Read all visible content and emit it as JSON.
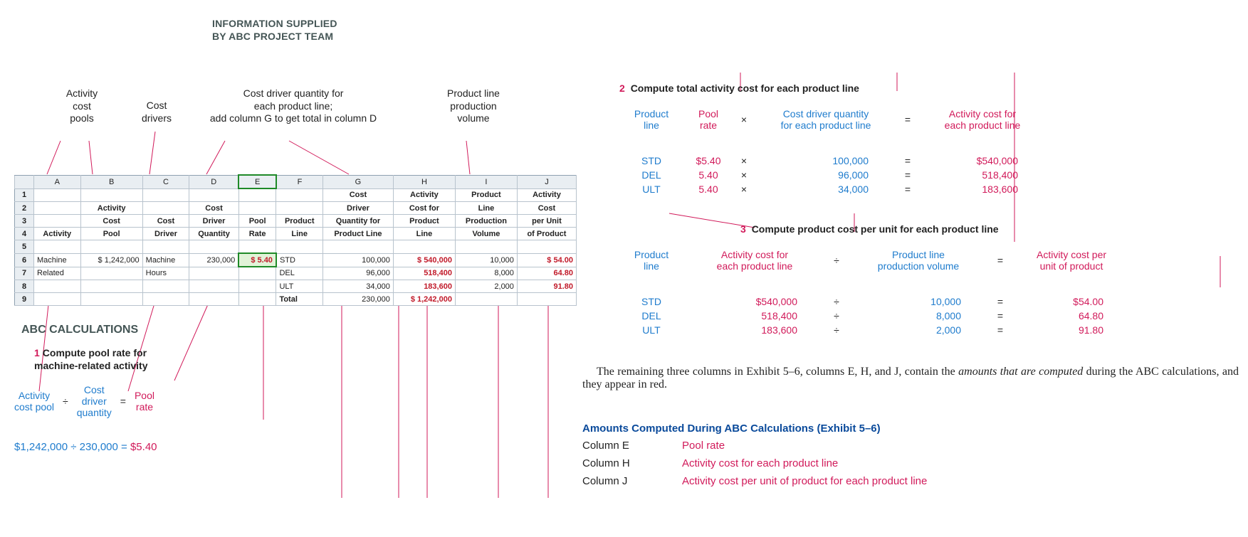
{
  "header": {
    "line1": "INFORMATION SUPPLIED",
    "line2": "BY ABC PROJECT TEAM"
  },
  "annotations": {
    "pools": "Activity\ncost\npools",
    "driver": "Cost\ndrivers",
    "qty": "Cost driver quantity for\neach product line;\nadd column G to get total in column D",
    "volume": "Product line\nproduction\nvolume"
  },
  "spreadsheet": {
    "cols": [
      "",
      "A",
      "B",
      "C",
      "D",
      "E",
      "F",
      "G",
      "H",
      "I",
      "J"
    ],
    "header_rows": [
      [
        "1",
        "",
        "",
        "",
        "",
        "",
        "",
        "Cost",
        "Activity",
        "Product",
        "Activity"
      ],
      [
        "2",
        "",
        "Activity",
        "",
        "Cost",
        "",
        "",
        "Driver",
        "Cost for",
        "Line",
        "Cost"
      ],
      [
        "3",
        "",
        "Cost",
        "Cost",
        "Driver",
        "Pool",
        "Product",
        "Quantity for",
        "Product",
        "Production",
        "per Unit"
      ],
      [
        "4",
        "Activity",
        "Pool",
        "Driver",
        "Quantity",
        "Rate",
        "Line",
        "Product Line",
        "Line",
        "Volume",
        "of Product"
      ]
    ],
    "data_rows": [
      {
        "n": "5",
        "cells": [
          "",
          "",
          "",
          "",
          "",
          "",
          "",
          "",
          "",
          ""
        ]
      },
      {
        "n": "6",
        "cells": [
          "Machine",
          "$ 1,242,000",
          "Machine",
          "230,000",
          "$        5.40",
          "STD",
          "100,000",
          "$    540,000",
          "10,000",
          "$           54.00"
        ],
        "red": [
          4,
          7,
          9
        ]
      },
      {
        "n": "7",
        "cells": [
          "Related",
          "",
          "Hours",
          "",
          "",
          "DEL",
          "96,000",
          "518,400",
          "8,000",
          "64.80"
        ],
        "red": [
          7,
          9
        ]
      },
      {
        "n": "8",
        "cells": [
          "",
          "",
          "",
          "",
          "",
          "ULT",
          "34,000",
          "183,600",
          "2,000",
          "91.80"
        ],
        "red": [
          7,
          9
        ]
      },
      {
        "n": "9",
        "cells": [
          "",
          "",
          "",
          "",
          "",
          "Total",
          "230,000",
          "$ 1,242,000",
          "",
          ""
        ],
        "red": [
          7
        ],
        "boldtop": true
      }
    ]
  },
  "abc_title": "ABC CALCULATIONS",
  "step1": {
    "num": "1",
    "text": "Compute pool rate for\nmachine-related activity"
  },
  "formula1": {
    "a": "Activity\ncost pool",
    "op1": "÷",
    "b": "Cost\ndriver\nquantity",
    "op2": "=",
    "c": "Pool\nrate"
  },
  "calc1": {
    "lhs": "$1,242,000 ÷ 230,000 = ",
    "rhs": "$5.40"
  },
  "step2": {
    "num": "2",
    "text": "Compute total activity cost for each product line"
  },
  "formula2": {
    "a": "Product\nline",
    "b": "Pool\nrate",
    "op1": "×",
    "c": "Cost driver quantity\nfor each product line",
    "op2": "=",
    "d": "Activity cost for\neach product line"
  },
  "grid2": [
    {
      "pl": "STD",
      "rate": "$5.40",
      "qty": "100,000",
      "cost": "$540,000"
    },
    {
      "pl": "DEL",
      "rate": "5.40",
      "qty": "96,000",
      "cost": "518,400"
    },
    {
      "pl": "ULT",
      "rate": "5.40",
      "qty": "34,000",
      "cost": "183,600"
    }
  ],
  "step3": {
    "num": "3",
    "text": "Compute product cost per unit for each product line"
  },
  "formula3": {
    "a": "Product\nline",
    "b": "Activity cost for\neach product line",
    "op1": "÷",
    "c": "Product line\nproduction volume",
    "op2": "=",
    "d": "Activity cost per\nunit of product"
  },
  "grid3": [
    {
      "pl": "STD",
      "cost": "$540,000",
      "vol": "10,000",
      "unit": "$54.00"
    },
    {
      "pl": "DEL",
      "cost": "518,400",
      "vol": "8,000",
      "unit": "64.80"
    },
    {
      "pl": "ULT",
      "cost": "183,600",
      "vol": "2,000",
      "unit": "91.80"
    }
  ],
  "paragraph": {
    "lead": "The remaining three columns in Exhibit 5–6, columns E, H, and J, contain the ",
    "em": "amounts that are computed",
    "tail": " during the ABC calculations, and they appear in red."
  },
  "subheading": "Amounts Computed During ABC Calculations (Exhibit 5–6)",
  "legend": [
    {
      "col": "Column E",
      "desc": "Pool rate"
    },
    {
      "col": "Column H",
      "desc": "Activity cost for each product line"
    },
    {
      "col": "Column J",
      "desc": "Activity cost per unit of product for each product line"
    }
  ],
  "ops": {
    "mul": "×",
    "div": "÷",
    "eq": "="
  },
  "chart_data": {
    "type": "table",
    "title": "ABC cost allocation — machine-related activity",
    "activity": "Machine Related",
    "cost_pool_usd": 1242000,
    "cost_driver": "Machine Hours",
    "cost_driver_quantity_total": 230000,
    "pool_rate_usd": 5.4,
    "product_lines": [
      {
        "name": "STD",
        "driver_qty": 100000,
        "activity_cost_usd": 540000,
        "production_volume": 10000,
        "cost_per_unit_usd": 54.0
      },
      {
        "name": "DEL",
        "driver_qty": 96000,
        "activity_cost_usd": 518400,
        "production_volume": 8000,
        "cost_per_unit_usd": 64.8
      },
      {
        "name": "ULT",
        "driver_qty": 34000,
        "activity_cost_usd": 183600,
        "production_volume": 2000,
        "cost_per_unit_usd": 91.8
      }
    ],
    "totals": {
      "driver_qty": 230000,
      "activity_cost_usd": 1242000
    }
  }
}
